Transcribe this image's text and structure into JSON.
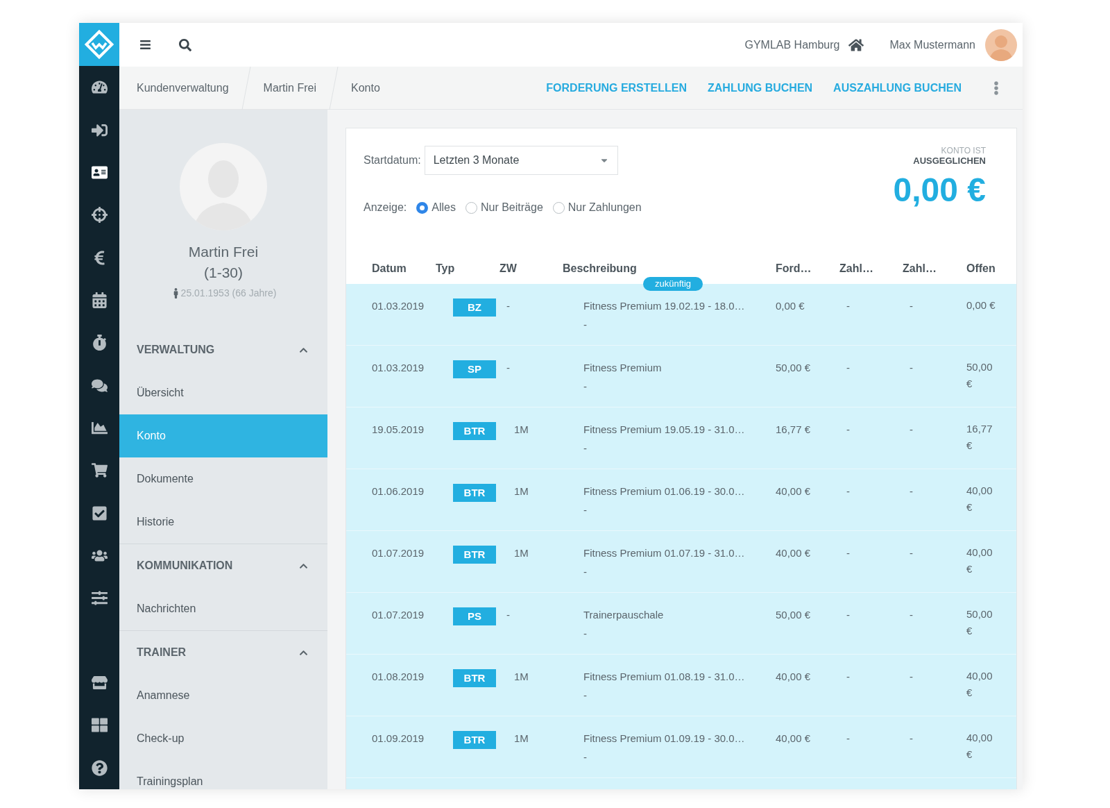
{
  "topbar": {
    "studio": "GYMLAB Hamburg",
    "user": "Max Mustermann"
  },
  "rail": [
    {
      "selected": false
    },
    {
      "selected": false
    },
    {
      "selected": true
    },
    {
      "selected": false
    },
    {
      "selected": false
    },
    {
      "selected": false
    },
    {
      "selected": false
    },
    {
      "selected": false
    },
    {
      "selected": false
    },
    {
      "selected": false
    },
    {
      "selected": false
    },
    {
      "selected": false
    },
    {
      "selected": false
    },
    {
      "selected": false
    },
    {
      "selected": false
    },
    {
      "selected": false
    }
  ],
  "breadcrumb": [
    "Kundenverwaltung",
    "Martin Frei",
    "Konto"
  ],
  "actions": [
    "FORDERUNG ERSTELLEN",
    "ZAHLUNG BUCHEN",
    "AUSZAHLUNG BUCHEN"
  ],
  "customer": {
    "name": "Martin Frei",
    "range": "(1-30)",
    "birth": "25.01.1953 (66 Jahre)"
  },
  "sidebar": [
    {
      "title": "VERWALTUNG",
      "expanded": true,
      "items": [
        {
          "label": "Übersicht",
          "selected": false
        },
        {
          "label": "Konto",
          "selected": true
        },
        {
          "label": "Dokumente",
          "selected": false
        },
        {
          "label": "Historie",
          "selected": false
        }
      ]
    },
    {
      "title": "KOMMUNIKATION",
      "expanded": true,
      "items": [
        {
          "label": "Nachrichten",
          "selected": false
        }
      ]
    },
    {
      "title": "TRAINER",
      "expanded": true,
      "items": [
        {
          "label": "Anamnese",
          "selected": false
        },
        {
          "label": "Check-up",
          "selected": false
        },
        {
          "label": "Trainingsplan",
          "selected": false
        }
      ]
    }
  ],
  "filter": {
    "label": "Startdatum:",
    "value": "Letzten 3 Monate"
  },
  "display": {
    "label": "Anzeige:",
    "options": [
      {
        "label": "Alles",
        "selected": true
      },
      {
        "label": "Nur Beiträge",
        "selected": false
      },
      {
        "label": "Nur Zahlungen",
        "selected": false
      }
    ]
  },
  "balance": {
    "caption": "KONTO IST",
    "status": "AUSGEGLICHEN",
    "amount": "0,00 €"
  },
  "table": {
    "columns": [
      "Datum",
      "Typ",
      "ZW",
      "Beschreibung",
      "Ford…",
      "Zahl…",
      "Zahl…",
      "Offen"
    ],
    "rows": [
      {
        "date": "01.03.2019",
        "type": "BZ",
        "zw": "-",
        "description": "Fitness Premium 19.02.19 - 18.0…",
        "note": "-",
        "ford": "0,00 €",
        "zahl1": "-",
        "zahl2": "-",
        "offen": "0,00 €",
        "tag": "zukünftig"
      },
      {
        "date": "01.03.2019",
        "type": "SP",
        "zw": "-",
        "description": "Fitness Premium",
        "note": "-",
        "ford": "50,00 €",
        "zahl1": "-",
        "zahl2": "-",
        "offen": "50,00 €"
      },
      {
        "date": "19.05.2019",
        "type": "BTR",
        "zw": "1M",
        "description": "Fitness Premium 19.05.19 - 31.0…",
        "note": "-",
        "ford": "16,77 €",
        "zahl1": "-",
        "zahl2": "-",
        "offen": "16,77 €"
      },
      {
        "date": "01.06.2019",
        "type": "BTR",
        "zw": "1M",
        "description": "Fitness Premium 01.06.19 - 30.0…",
        "note": "-",
        "ford": "40,00 €",
        "zahl1": "-",
        "zahl2": "-",
        "offen": "40,00 €"
      },
      {
        "date": "01.07.2019",
        "type": "BTR",
        "zw": "1M",
        "description": "Fitness Premium 01.07.19 - 31.0…",
        "note": "-",
        "ford": "40,00 €",
        "zahl1": "-",
        "zahl2": "-",
        "offen": "40,00 €"
      },
      {
        "date": "01.07.2019",
        "type": "PS",
        "zw": "-",
        "description": "Trainerpauschale",
        "note": "-",
        "ford": "50,00 €",
        "zahl1": "-",
        "zahl2": "-",
        "offen": "50,00 €"
      },
      {
        "date": "01.08.2019",
        "type": "BTR",
        "zw": "1M",
        "description": "Fitness Premium 01.08.19 - 31.0…",
        "note": "-",
        "ford": "40,00 €",
        "zahl1": "-",
        "zahl2": "-",
        "offen": "40,00 €"
      },
      {
        "date": "01.09.2019",
        "type": "BTR",
        "zw": "1M",
        "description": "Fitness Premium 01.09.19 - 30.0…",
        "note": "-",
        "ford": "40,00 €",
        "zahl1": "-",
        "zahl2": "-",
        "offen": "40,00 €"
      }
    ]
  }
}
